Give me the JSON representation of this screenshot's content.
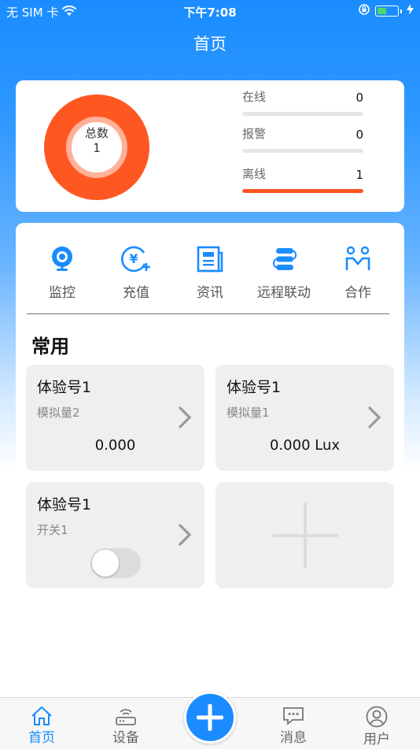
{
  "status_bar": {
    "carrier": "无 SIM 卡",
    "time": "下午7:08"
  },
  "nav": {
    "title": "首页"
  },
  "summary": {
    "total_label": "总数",
    "total_value": "1",
    "stats": [
      {
        "label": "在线",
        "value": "0",
        "fraction": 0
      },
      {
        "label": "报警",
        "value": "0",
        "fraction": 0
      },
      {
        "label": "离线",
        "value": "1",
        "fraction": 1
      }
    ]
  },
  "shortcuts": [
    {
      "label": "监控",
      "icon": "camera-icon"
    },
    {
      "label": "充值",
      "icon": "recharge-icon"
    },
    {
      "label": "资讯",
      "icon": "news-icon"
    },
    {
      "label": "远程联动",
      "icon": "linkage-icon"
    },
    {
      "label": "合作",
      "icon": "partner-icon"
    }
  ],
  "common": {
    "title": "常用",
    "tiles": [
      {
        "title": "体验号1",
        "subtitle": "模拟量2",
        "value": "0.000"
      },
      {
        "title": "体验号1",
        "subtitle": "模拟量1",
        "value": "0.000 Lux"
      },
      {
        "title": "体验号1",
        "subtitle": "开关1",
        "switch_on": false
      }
    ]
  },
  "tabs": [
    {
      "label": "首页",
      "icon": "home-icon",
      "active": true
    },
    {
      "label": "设备",
      "icon": "router-icon",
      "active": false
    },
    {
      "label": "消息",
      "icon": "message-icon",
      "active": false
    },
    {
      "label": "用户",
      "icon": "user-icon",
      "active": false
    }
  ],
  "colors": {
    "primary": "#1a8cff",
    "accent": "#ff5722"
  }
}
